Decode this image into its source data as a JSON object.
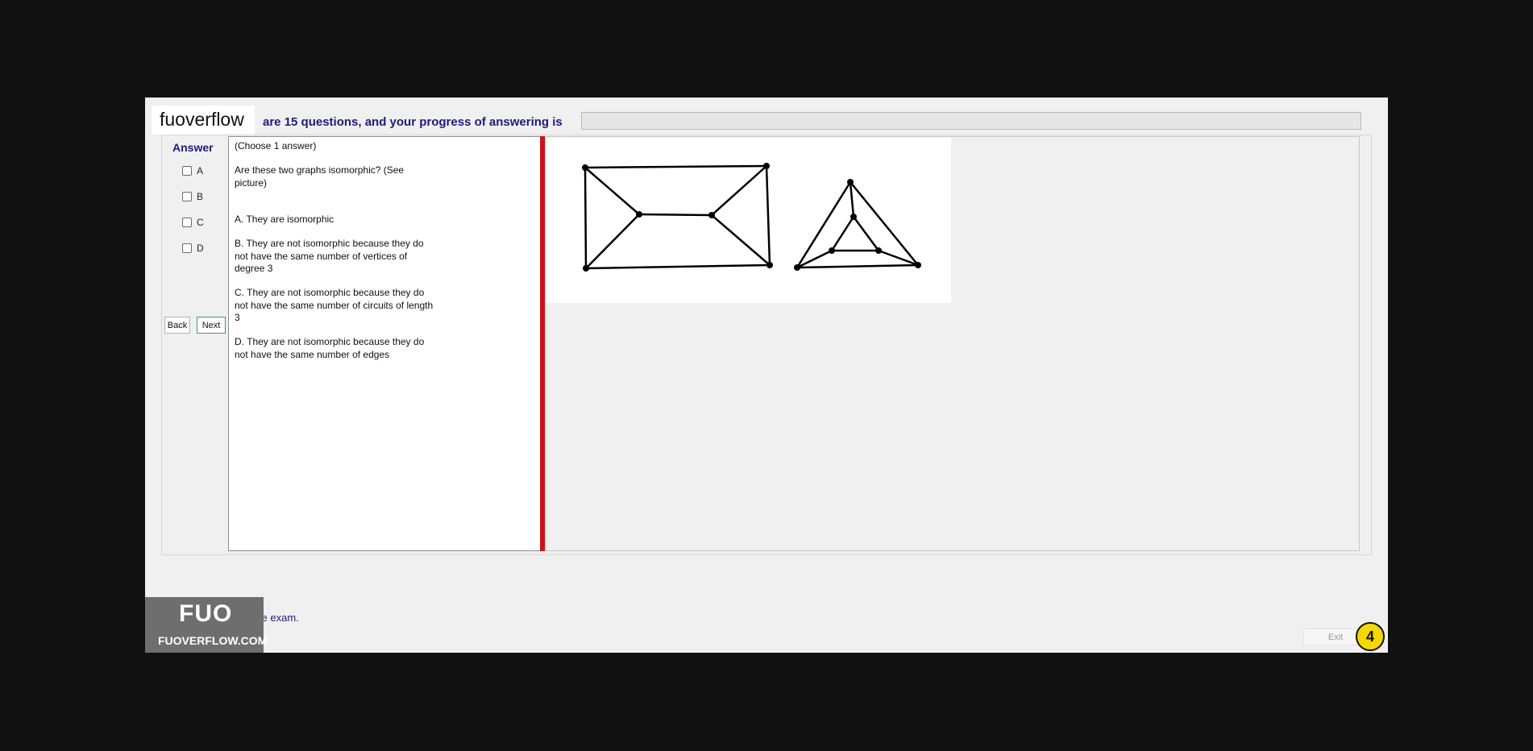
{
  "header": {
    "logo": "fuoverflow",
    "progress_text": "are 15 questions, and your progress of answering is",
    "progress_fraction": 0
  },
  "answer_panel": {
    "label": "Answer",
    "options": [
      "A",
      "B",
      "C",
      "D"
    ]
  },
  "nav": {
    "back": "Back",
    "next": "Next"
  },
  "question": {
    "instruction": "(Choose 1 answer)",
    "prompt": "Are these two graphs isomorphic? (See picture)",
    "choices": [
      "A.  They are isomorphic",
      "B.  They are not isomorphic because they do not have the same number of vertices of degree 3",
      "C.  They are not isomorphic because they do not have the same number of circuits of length 3",
      "D.  They are not isomorphic because they do not have the same number of edges"
    ]
  },
  "footer": {
    "finish_label": "I want to finish the exam.",
    "exit": "Exit",
    "step_number": "4"
  },
  "watermark": {
    "big": "FUO",
    "small": "FUOVERFLOW.COM"
  },
  "colors": {
    "divider": "#c8161a",
    "header_text": "#1c1c7a",
    "badge": "#f5d800"
  }
}
